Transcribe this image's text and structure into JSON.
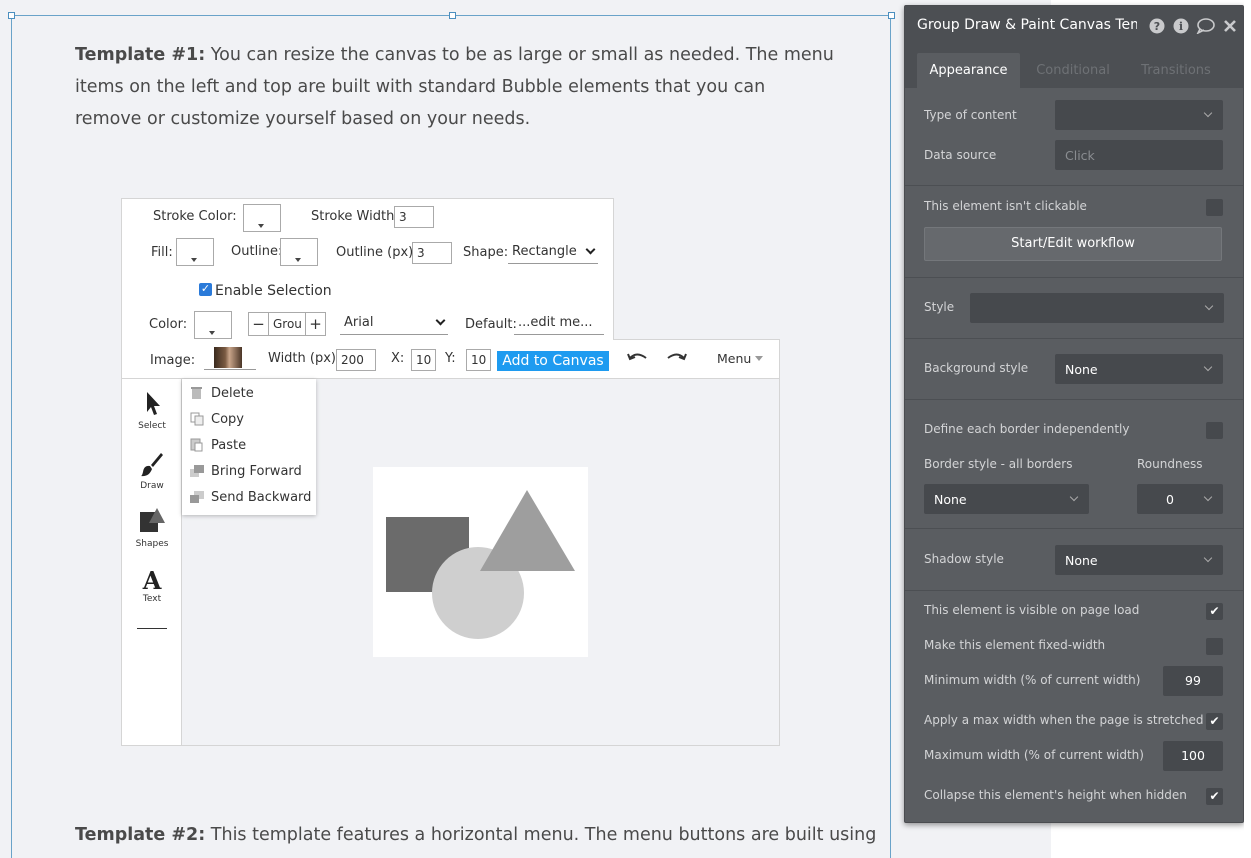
{
  "editor": {
    "paragraph1_bold": "Template #1:",
    "paragraph1_text": " You can resize the canvas to be as large or small as needed. The menu items on the left and top are built with standard Bubble elements that you can remove or customize yourself based on your needs.",
    "paragraph2_bold": "Template #2:",
    "paragraph2_text": " This template features a horizontal menu. The menu buttons are built using"
  },
  "toolbar": {
    "stroke_color_label": "Stroke Color:",
    "stroke_width_label": "Stroke Width:",
    "stroke_width_value": "3",
    "fill_label": "Fill:",
    "outline_label": "Outline:",
    "outline_px_label": "Outline (px):",
    "outline_px_value": "3",
    "shape_label": "Shape:",
    "shape_value": "Rectangle",
    "enable_selection_label": "Enable Selection",
    "color_label": "Color:",
    "font_size_value": "Grou",
    "font_value": "Arial",
    "default_label": "Default:",
    "default_value": "...edit me...",
    "image_label": "Image:",
    "width_label": "Width (px):",
    "width_value": "200",
    "x_label": "X:",
    "x_value": "10",
    "y_label": "Y:",
    "y_value": "10",
    "add_button": "Add to Canvas",
    "menu_label": "Menu"
  },
  "rail": {
    "select": "Select",
    "draw": "Draw",
    "shapes": "Shapes",
    "text": "Text"
  },
  "context_menu": {
    "delete": "Delete",
    "copy": "Copy",
    "paste": "Paste",
    "bring_forward": "Bring Forward",
    "send_backward": "Send Backward"
  },
  "panel": {
    "title": "Group Draw & Paint Canvas Temp",
    "tabs": [
      "Appearance",
      "Conditional",
      "Transitions"
    ],
    "type_of_content_label": "Type of content",
    "data_source_label": "Data source",
    "data_source_placeholder": "Click",
    "not_clickable_label": "This element isn't clickable",
    "workflow_button": "Start/Edit workflow",
    "style_label": "Style",
    "background_style_label": "Background style",
    "background_style_value": "None",
    "border_independent_label": "Define each border independently",
    "border_style_label": "Border style - all borders",
    "border_style_value": "None",
    "roundness_label": "Roundness",
    "roundness_value": "0",
    "shadow_style_label": "Shadow style",
    "shadow_style_value": "None",
    "visible_on_load_label": "This element is visible on page load",
    "fixed_width_label": "Make this element fixed-width",
    "min_width_label": "Minimum width (% of current width)",
    "min_width_value": "99",
    "max_width_apply_label": "Apply a max width when the page is stretched",
    "max_width_label": "Maximum width (% of current width)",
    "max_width_value": "100",
    "collapse_label": "Collapse this element's height when hidden"
  },
  "colors": {
    "accent_blue": "#1e9bf0",
    "panel_bg": "#5a5d61",
    "selection_border": "#6aa3c9"
  }
}
